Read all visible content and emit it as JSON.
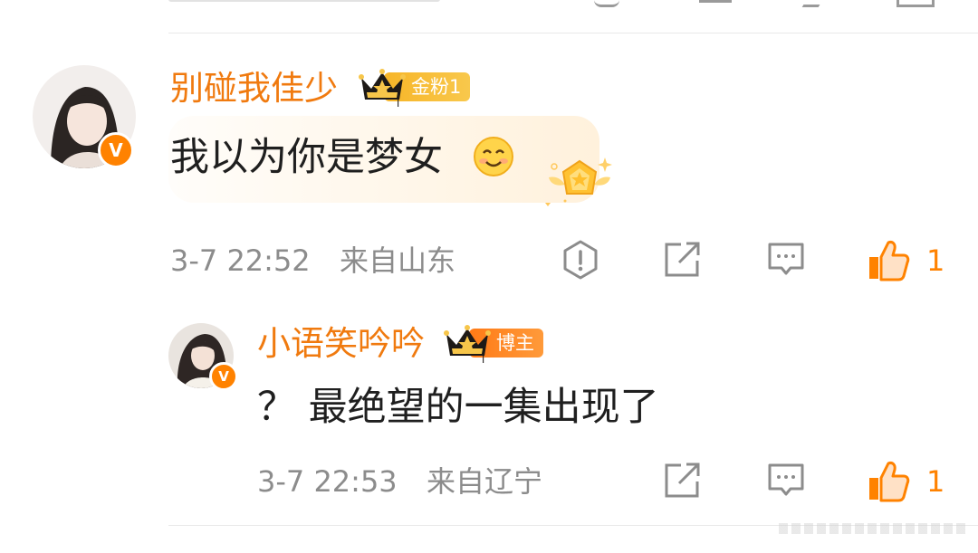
{
  "comments": [
    {
      "username": "别碰我佳少",
      "badge": "金粉1",
      "badge_level": "I",
      "verified": "V",
      "text": "我以为你是梦女",
      "time": "3-7 22:52",
      "location": "来自山东",
      "likes": "1"
    },
    {
      "username": "小语笑吟吟",
      "badge": "博主",
      "badge_level": "I",
      "verified": "V",
      "text": "？ 最绝望的一集出现了",
      "time": "3-7 22:53",
      "location": "来自辽宁",
      "likes": "1"
    }
  ],
  "colors": {
    "username": "#f07a0f",
    "like_icon": "#ff8200",
    "action_icon": "#8c8c8c"
  },
  "icons": {
    "report": "report-icon",
    "share": "share-icon",
    "comment": "comment-icon",
    "like": "like-icon",
    "emoji": "smile-emoji-icon",
    "crown": "crown-icon"
  }
}
